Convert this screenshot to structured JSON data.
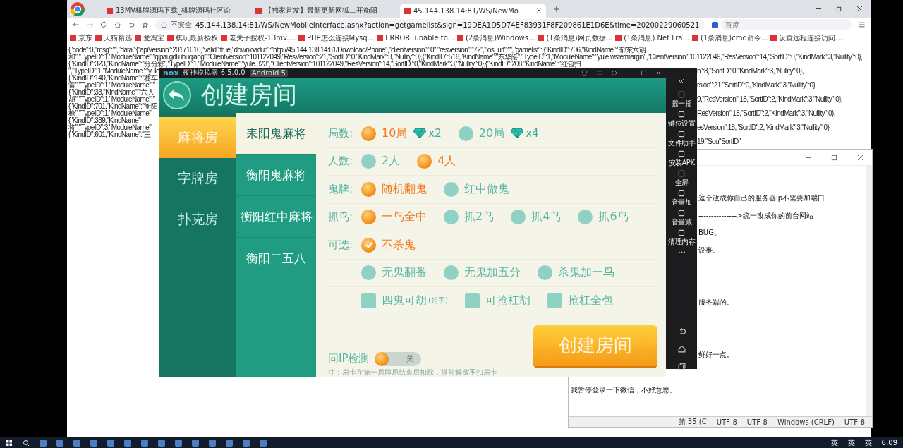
{
  "browser": {
    "tabs": [
      {
        "title": "13MV棋牌源码下载_棋牌源码社区论",
        "selected": false
      },
      {
        "title": "【独家首发】最新更新网狐二开衡阳",
        "selected": false
      },
      {
        "title": "45.144.138.14:81/WS/NewMo",
        "selected": true
      }
    ],
    "security_label": "不安全",
    "url": "45.144.138.14:81/WS/NewMobileInterface.ashx?action=getgamelist&sign=19DEA1D5D74EF83931F8F209861E1D6E&time=20200229060521",
    "search_placeholder": "百度",
    "bookmarks": [
      "京东",
      "天猫精选",
      "爱淘宝",
      "棋玩最新授权",
      "老夫子授权-13mv....",
      "PHP怎么连接Mysq...",
      "ERROR: unable to...",
      "(2条消息)Windows...",
      "(1条消息)网页数据...",
      "(1条消息).Net Fra...",
      "(1条消息)cmd命令...",
      "设置远程连接访问..."
    ]
  },
  "page_text": {
    "lines": [
      {
        "text": "{\"code\":0,\"msg\":\"\",\"data\":{\"apiVersion\":20171010,\"valid\":true,\"downloadurl\":\"http://45.144.138.14:81/Download/Phone\",\"clientversion\":\"0\",\"resversion\":\"72\",\"ios_url\":\"\",\"gamelist\":[{\"KindID\":706,\"KindName\":\"郁东六胡"
      },
      {
        "text": "和\",\"TypeID\":1,\"ModuleName\":\"qipai.gdliuhuqiang\",\"ClientVersion\":101122049,\"ResVersion\":21,\"SortID\":0,\"KindMark\":3,\"Nullity\":0},{\"KindID\":516,\"KindName\":\"东华侩\",\"TypeID\":1,\"ModuleName\":\"yule.wstermargin\",\"ClientVersion\":101122049,\"ResVersion\":14,\"SortID\":0,\"KindMark\":3,\"Nullity\":0},"
      },
      {
        "text": "{\"KindID\":323,\"KindName\":\"分分彩\",\"TypeID\":1,\"ModuleName\":\"yule.323\",\"ClientVersion\":101122049,\"ResVersion\":14,\"SortID\":0,\"KindMark\":3,\"Nullity\":0},{\"KindID\":208,\"KindName\":\"红包扫"
      },
      {
        "left": "\",\"TypeID\":1,\"ModuleName\":\"yule",
        "right": "n\":8,\"SortID\":0,\"KindMark\":3,\"Nullity\":0},"
      },
      {
        "left": "{\"KindID\":140,\"KindName\":\"赛车"
      },
      {
        "left": "雷\",\"TypeID\":1,\"ModuleName\":\"",
        "right": "rsion\":21,\"SortID\":0,\"KindMark\":3,\"Nullity\":0},"
      },
      {
        "left": "{\"KindID\":33,\"KindName\":\"六人"
      },
      {
        "left": "胡\",\"TypeID\":1,\"ModuleName\":\"",
        "right": "9,\"ResVersion\":18,\"SortID\":2,\"KindMark\":3,\"Nullity\":0},"
      },
      {
        "left": "{\"KindID\":701,\"KindName\":\"衡阳"
      },
      {
        "left": "枪\",\"TypeID\":1,\"ModuleName\"",
        "right": "ResVersion\":18,\"SortID\":2,\"KindMark\":3,\"Nullity\":0},"
      },
      {
        "left": "{\"KindID\":389,\"KindName\""
      },
      {
        "left": "将\",\"TypeID\":3,\"ModuleName\"",
        "right": "esVersion\":18,\"SortID\":2,\"KindMark\":3,\"Nullity\":0},"
      },
      {
        "left": "{\"KindID\":601,\"KindName\":\"三"
      },
      {
        "right": "19,\"Sou\"SortID\""
      }
    ]
  },
  "emulator": {
    "brand": "nox",
    "title": "夜神模拟器 6.5.0.0",
    "android_badge": "Android 5",
    "sidebar": [
      "摇一摇",
      "键位设置",
      "文件助手",
      "安装APK",
      "全屏",
      "音量加",
      "音量减",
      "清理内存"
    ],
    "app": {
      "title": "创建房间",
      "categories": [
        {
          "label": "麻将房",
          "selected": true
        },
        {
          "label": "字牌房",
          "selected": false
        },
        {
          "label": "扑克房",
          "selected": false
        }
      ],
      "games": [
        {
          "label": "耒阳鬼麻将",
          "selected": true
        },
        {
          "label": "衡阳鬼麻将",
          "selected": false
        },
        {
          "label": "衡阳红中麻将",
          "selected": false
        },
        {
          "label": "衡阳二五八",
          "selected": false
        }
      ],
      "rows": [
        {
          "label": "局数:",
          "options": [
            {
              "kind": "radio",
              "text": "10局",
              "suffix": "x2",
              "selected": true
            },
            {
              "kind": "radio",
              "text": "20局",
              "suffix": "x4",
              "selected": false
            }
          ]
        },
        {
          "label": "人数:",
          "options": [
            {
              "kind": "radio",
              "text": "2人",
              "selected": false
            },
            {
              "kind": "radio",
              "text": "4人",
              "selected": true
            }
          ]
        },
        {
          "label": "鬼牌:",
          "options": [
            {
              "kind": "radio",
              "text": "随机翻鬼",
              "selected": true
            },
            {
              "kind": "radio",
              "text": "红中做鬼",
              "selected": false
            }
          ]
        },
        {
          "label": "抓鸟:",
          "options": [
            {
              "kind": "radio",
              "text": "一鸟全中",
              "selected": true
            },
            {
              "kind": "radio",
              "text": "抓2鸟",
              "selected": false
            },
            {
              "kind": "radio",
              "text": "抓4鸟",
              "selected": false
            },
            {
              "kind": "radio",
              "text": "抓6鸟",
              "selected": false
            }
          ]
        },
        {
          "label": "可选:",
          "options": [
            {
              "kind": "check-round",
              "text": "不杀鬼",
              "checked": true
            }
          ]
        },
        {
          "options": [
            {
              "kind": "check-round",
              "text": "无鬼翻番",
              "checked": false
            },
            {
              "kind": "check-round",
              "text": "无鬼加五分",
              "checked": false
            },
            {
              "kind": "check-round",
              "text": "杀鬼加一鸟",
              "checked": false
            }
          ]
        },
        {
          "options": [
            {
              "kind": "check-square",
              "text": "四鬼可胡",
              "note": "(起手)",
              "checked": false
            },
            {
              "kind": "check-square",
              "text": "可抢杠胡",
              "checked": false
            },
            {
              "kind": "check-square",
              "text": "抢杠全包",
              "checked": false
            }
          ]
        }
      ],
      "ip_check": {
        "label": "同IP检测",
        "on": false,
        "state_text": "关"
      },
      "create_button": "创建房间",
      "note": "注：房卡在第一局牌局结束后扣除，提前解散不扣房卡"
    }
  },
  "notepad": {
    "lines": [
      {
        "kind": "partial",
        "text": "这个改成你自己的服务器ip不需要加端口"
      },
      {
        "kind": "partial",
        "text": "--------------->统一改成你的前台网站"
      },
      {
        "kind": "partial",
        "text": "BUG。"
      },
      {
        "kind": "partial",
        "text": "设事。"
      },
      {
        "kind": "blank"
      },
      {
        "kind": "blank"
      },
      {
        "kind": "partial",
        "text": "服务端的。"
      },
      {
        "kind": "blank"
      },
      {
        "kind": "blank"
      },
      {
        "kind": "partial",
        "text": "鲜好一点。"
      },
      {
        "kind": "blank"
      },
      {
        "kind": "full",
        "text": "我暂停登录一下微信，不好意思。"
      }
    ],
    "status": [
      "第 35 (C",
      "UTF-8",
      "UTF-8",
      "Windows (CRLF)",
      "UTF-8"
    ]
  },
  "taskbar": {
    "tray_labels": [
      "英",
      "英",
      "英"
    ],
    "time": "6:09"
  }
}
